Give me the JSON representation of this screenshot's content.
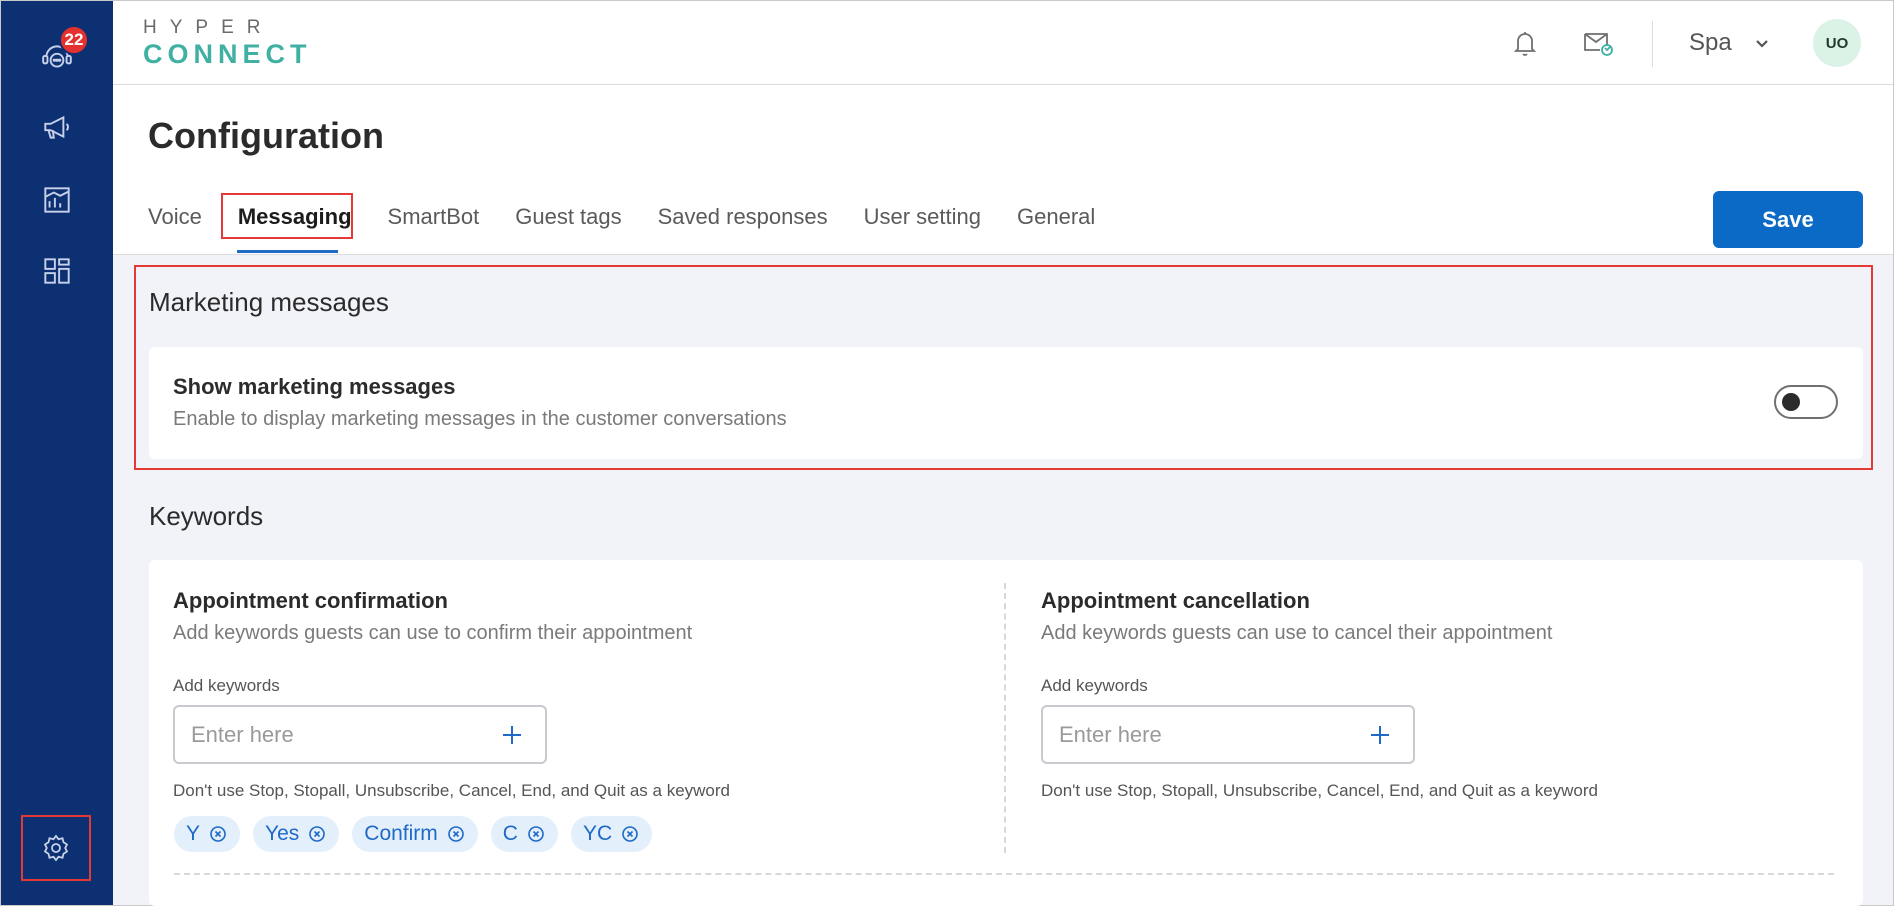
{
  "app": {
    "logo_top": "HYPER",
    "logo_bottom": "CONNECT",
    "notification_count": "22"
  },
  "header": {
    "location": "Spa",
    "avatar_initials": "UO"
  },
  "page": {
    "title": "Configuration",
    "tabs": [
      {
        "label": "Voice"
      },
      {
        "label": "Messaging"
      },
      {
        "label": "SmartBot"
      },
      {
        "label": "Guest tags"
      },
      {
        "label": "Saved responses"
      },
      {
        "label": "User setting"
      },
      {
        "label": "General"
      }
    ],
    "active_tab": "Messaging",
    "save_label": "Save"
  },
  "marketing": {
    "section_title": "Marketing messages",
    "title": "Show marketing messages",
    "description": "Enable to display marketing messages in the customer conversations",
    "enabled": false
  },
  "keywords": {
    "section_title": "Keywords",
    "confirmation": {
      "title": "Appointment confirmation",
      "description": "Add keywords guests can use to confirm their appointment",
      "field_label": "Add keywords",
      "placeholder": "Enter here",
      "hint": "Don't use Stop, Stopall, Unsubscribe, Cancel, End, and Quit as a keyword",
      "chips": [
        "Y",
        "Yes",
        "Confirm",
        "C",
        "YC"
      ]
    },
    "cancellation": {
      "title": "Appointment cancellation",
      "description": "Add keywords guests can use to cancel their appointment",
      "field_label": "Add keywords",
      "placeholder": "Enter here",
      "hint": "Don't use Stop, Stopall, Unsubscribe, Cancel, End, and Quit as a keyword"
    }
  },
  "colors": {
    "sidebar": "#0d3073",
    "primary": "#0a6ac5",
    "highlight": "#e53935",
    "logo_accent": "#3fb0a2",
    "chip_bg": "#e3effb"
  }
}
